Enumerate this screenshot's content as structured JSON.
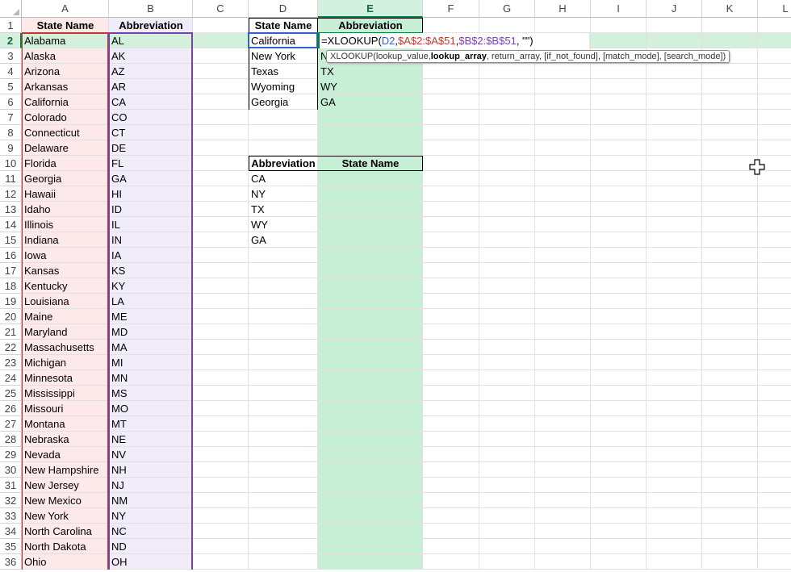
{
  "columns": [
    "A",
    "B",
    "C",
    "D",
    "E",
    "F",
    "G",
    "H",
    "I",
    "J",
    "K",
    "L"
  ],
  "rows": [
    "1",
    "2",
    "3",
    "4",
    "5",
    "6",
    "7",
    "8",
    "9",
    "10",
    "11",
    "12",
    "13",
    "14",
    "15",
    "16",
    "17",
    "18",
    "19",
    "20",
    "21",
    "22",
    "23",
    "24",
    "25",
    "26",
    "27",
    "28",
    "29",
    "30",
    "31",
    "32",
    "33",
    "34",
    "35",
    "36"
  ],
  "headers": {
    "a1": "State Name",
    "b1": "Abbreviation",
    "d1": "State Name",
    "e1": "Abbreviation",
    "d10": "Abbreviation",
    "e10": "State Name"
  },
  "states": [
    {
      "name": "Alabama",
      "abbr": "AL"
    },
    {
      "name": "Alaska",
      "abbr": "AK"
    },
    {
      "name": "Arizona",
      "abbr": "AZ"
    },
    {
      "name": "Arkansas",
      "abbr": "AR"
    },
    {
      "name": "California",
      "abbr": "CA"
    },
    {
      "name": "Colorado",
      "abbr": "CO"
    },
    {
      "name": "Connecticut",
      "abbr": "CT"
    },
    {
      "name": "Delaware",
      "abbr": "DE"
    },
    {
      "name": "Florida",
      "abbr": "FL"
    },
    {
      "name": "Georgia",
      "abbr": "GA"
    },
    {
      "name": "Hawaii",
      "abbr": "HI"
    },
    {
      "name": "Idaho",
      "abbr": "ID"
    },
    {
      "name": "Illinois",
      "abbr": "IL"
    },
    {
      "name": "Indiana",
      "abbr": "IN"
    },
    {
      "name": "Iowa",
      "abbr": "IA"
    },
    {
      "name": "Kansas",
      "abbr": "KS"
    },
    {
      "name": "Kentucky",
      "abbr": "KY"
    },
    {
      "name": "Louisiana",
      "abbr": "LA"
    },
    {
      "name": "Maine",
      "abbr": "ME"
    },
    {
      "name": "Maryland",
      "abbr": "MD"
    },
    {
      "name": "Massachusetts",
      "abbr": "MA"
    },
    {
      "name": "Michigan",
      "abbr": "MI"
    },
    {
      "name": "Minnesota",
      "abbr": "MN"
    },
    {
      "name": "Mississippi",
      "abbr": "MS"
    },
    {
      "name": "Missouri",
      "abbr": "MO"
    },
    {
      "name": "Montana",
      "abbr": "MT"
    },
    {
      "name": "Nebraska",
      "abbr": "NE"
    },
    {
      "name": "Nevada",
      "abbr": "NV"
    },
    {
      "name": "New Hampshire",
      "abbr": "NH"
    },
    {
      "name": "New Jersey",
      "abbr": "NJ"
    },
    {
      "name": "New Mexico",
      "abbr": "NM"
    },
    {
      "name": "New York",
      "abbr": "NY"
    },
    {
      "name": "North Carolina",
      "abbr": "NC"
    },
    {
      "name": "North Dakota",
      "abbr": "ND"
    },
    {
      "name": "Ohio",
      "abbr": "OH"
    }
  ],
  "lookup_names": [
    "California",
    "New York",
    "Texas",
    "Wyoming",
    "Georgia"
  ],
  "lookup_abbr_results": [
    "N",
    "TX",
    "WY",
    "GA"
  ],
  "reverse_abbrs": [
    "CA",
    "NY",
    "TX",
    "WY",
    "GA"
  ],
  "formula": {
    "prefix": "=XLOOKUP(",
    "arg1": "D2",
    "sep1": ", ",
    "arg2": "$A$2:$A$51",
    "sep2": ", ",
    "arg3": "$B$2:$B$51",
    "suffix": ", \"\")"
  },
  "tooltip": {
    "fn": "XLOOKUP(",
    "p1": "lookup_value, ",
    "p2": "lookup_array",
    "p3": ", return_array, [if_not_found], [match_mode], [search_mode])"
  },
  "colors": {
    "name_col": "#fde9e9",
    "abbr_col": "#f0ecfa",
    "result_col": "#c6efd5",
    "row_highlight": "#d2f0dc",
    "ref_d2": "#2f5fd0",
    "ref_a": "#c0392b",
    "ref_b": "#7b3fa8"
  }
}
